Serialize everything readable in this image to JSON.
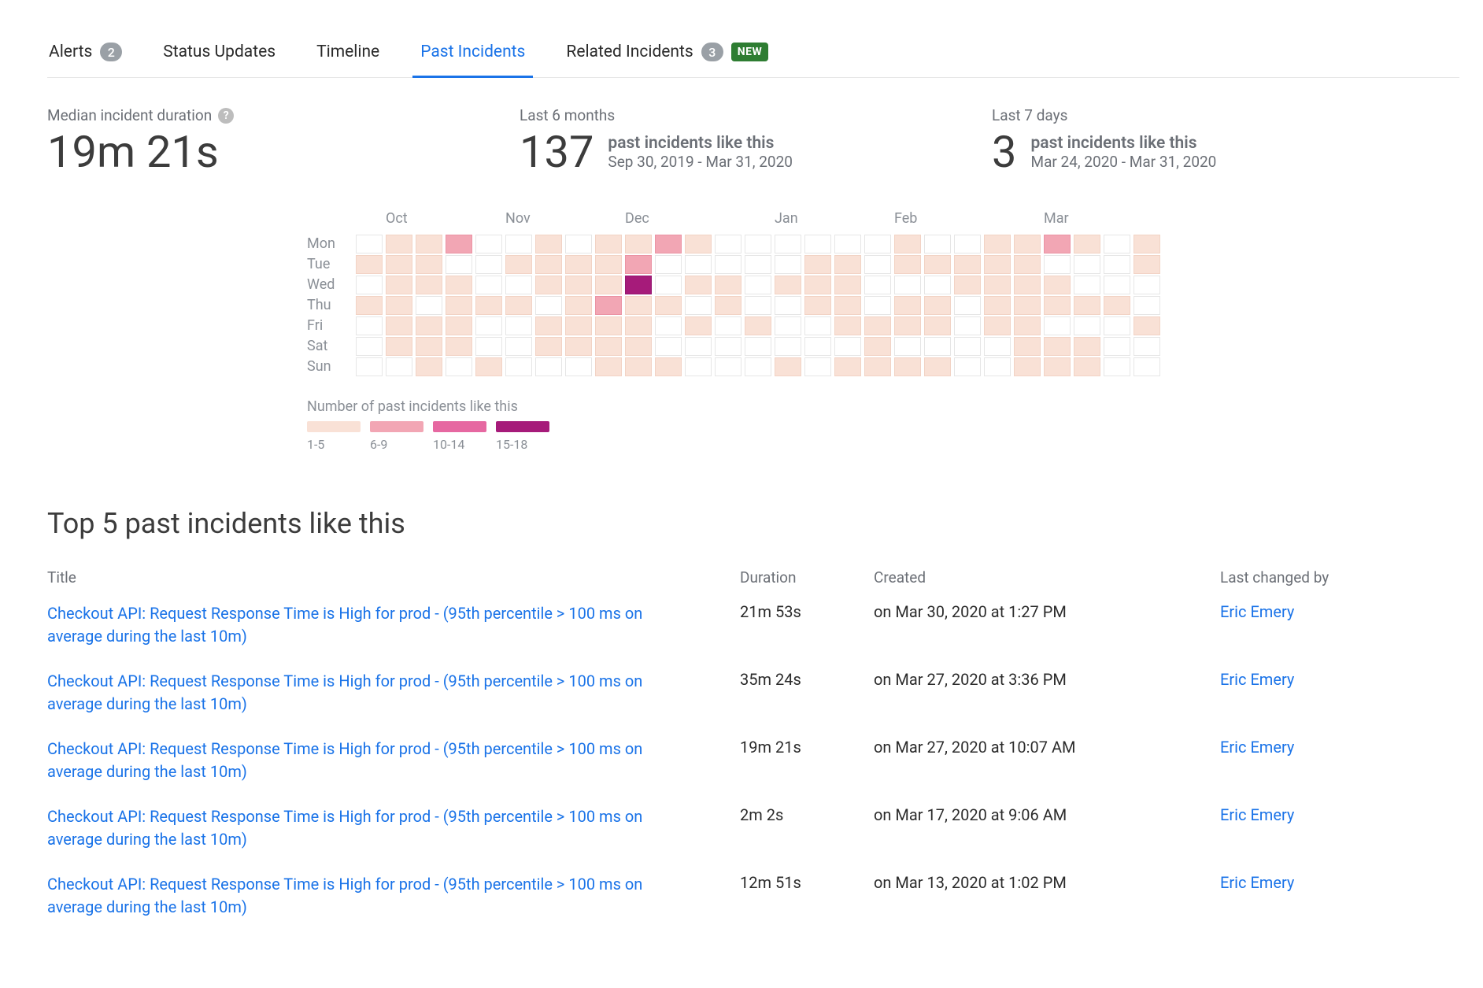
{
  "tabs": [
    {
      "label": "Alerts",
      "count": "2",
      "active": false,
      "new": false
    },
    {
      "label": "Status Updates",
      "count": null,
      "active": false,
      "new": false
    },
    {
      "label": "Timeline",
      "count": null,
      "active": false,
      "new": false
    },
    {
      "label": "Past Incidents",
      "count": null,
      "active": true,
      "new": false
    },
    {
      "label": "Related Incidents",
      "count": "3",
      "active": false,
      "new": true
    }
  ],
  "new_badge": "NEW",
  "summary": {
    "median_label": "Median incident duration",
    "median_value": "19m 21s",
    "six_months": {
      "label": "Last 6 months",
      "value": "137",
      "line1": "past incidents like this",
      "line2": "Sep 30, 2019 - Mar 31, 2020"
    },
    "seven_days": {
      "label": "Last 7 days",
      "value": "3",
      "line1": "past incidents like this",
      "line2": "Mar 24, 2020 - Mar 31, 2020"
    }
  },
  "heatmap": {
    "months": [
      "Oct",
      "Nov",
      "Dec",
      "Jan",
      "Feb",
      "Mar"
    ],
    "days": [
      "Mon",
      "Tue",
      "Wed",
      "Thu",
      "Fri",
      "Sat",
      "Sun"
    ],
    "legend_title": "Number of past incidents like this",
    "legend": [
      {
        "label": "1-5",
        "class": "lvl1"
      },
      {
        "label": "6-9",
        "class": "lvl2"
      },
      {
        "label": "10-14",
        "class": "lvl3"
      },
      {
        "label": "15-18",
        "class": "lvl4"
      }
    ]
  },
  "chart_data": {
    "type": "heatmap",
    "title": "Number of past incidents like this",
    "x_categories_months": [
      "Oct",
      "Nov",
      "Dec",
      "Jan",
      "Feb",
      "Mar"
    ],
    "y_categories": [
      "Mon",
      "Tue",
      "Wed",
      "Thu",
      "Fri",
      "Sat",
      "Sun"
    ],
    "levels_meaning": {
      "0": "none",
      "1": "1-5",
      "2": "6-9",
      "3": "10-14",
      "4": "15-18"
    },
    "values": [
      [
        0,
        1,
        1,
        2,
        0,
        0,
        1,
        0,
        1,
        1,
        2,
        1,
        0,
        0,
        0,
        0,
        0,
        0,
        1,
        0,
        0,
        1,
        1,
        2,
        1,
        0,
        1
      ],
      [
        1,
        1,
        1,
        0,
        0,
        1,
        1,
        1,
        1,
        2,
        0,
        0,
        0,
        0,
        0,
        1,
        1,
        0,
        1,
        1,
        1,
        1,
        1,
        0,
        0,
        0,
        1
      ],
      [
        0,
        1,
        1,
        1,
        0,
        0,
        1,
        1,
        1,
        4,
        0,
        1,
        1,
        0,
        1,
        1,
        1,
        0,
        0,
        0,
        1,
        1,
        1,
        1,
        0,
        0,
        0
      ],
      [
        1,
        1,
        0,
        1,
        1,
        1,
        0,
        1,
        2,
        1,
        1,
        0,
        1,
        0,
        0,
        1,
        1,
        0,
        1,
        1,
        0,
        1,
        1,
        1,
        1,
        1,
        0
      ],
      [
        0,
        1,
        1,
        1,
        0,
        0,
        1,
        1,
        1,
        1,
        0,
        1,
        0,
        1,
        0,
        0,
        1,
        1,
        1,
        1,
        0,
        1,
        1,
        0,
        0,
        0,
        1
      ],
      [
        0,
        1,
        1,
        1,
        0,
        0,
        1,
        1,
        1,
        1,
        0,
        0,
        0,
        0,
        0,
        0,
        0,
        1,
        0,
        0,
        0,
        0,
        1,
        1,
        1,
        0,
        0
      ],
      [
        0,
        0,
        1,
        0,
        1,
        0,
        0,
        0,
        1,
        1,
        1,
        0,
        0,
        0,
        1,
        0,
        1,
        1,
        1,
        1,
        0,
        0,
        1,
        1,
        1,
        0,
        0
      ]
    ]
  },
  "top5": {
    "heading": "Top 5 past incidents like this",
    "columns": {
      "title": "Title",
      "duration": "Duration",
      "created": "Created",
      "changed_by": "Last changed by"
    },
    "rows": [
      {
        "title": "Checkout API: Request Response Time is High for prod - (95th percentile > 100 ms on average during the last 10m)",
        "duration": "21m 53s",
        "created": "on Mar 30, 2020 at 1:27 PM",
        "changed_by": "Eric Emery"
      },
      {
        "title": "Checkout API: Request Response Time is High for prod - (95th percentile > 100 ms on average during the last 10m)",
        "duration": "35m 24s",
        "created": "on Mar 27, 2020 at 3:36 PM",
        "changed_by": "Eric Emery"
      },
      {
        "title": "Checkout API: Request Response Time is High for prod - (95th percentile > 100 ms on average during the last 10m)",
        "duration": "19m 21s",
        "created": "on Mar 27, 2020 at 10:07 AM",
        "changed_by": "Eric Emery"
      },
      {
        "title": "Checkout API: Request Response Time is High for prod - (95th percentile > 100 ms on average during the last 10m)",
        "duration": "2m 2s",
        "created": "on Mar 17, 2020 at 9:06 AM",
        "changed_by": "Eric Emery"
      },
      {
        "title": "Checkout API: Request Response Time is High for prod - (95th percentile > 100 ms on average during the last 10m)",
        "duration": "12m 51s",
        "created": "on Mar 13, 2020 at 1:02 PM",
        "changed_by": "Eric Emery"
      }
    ]
  }
}
